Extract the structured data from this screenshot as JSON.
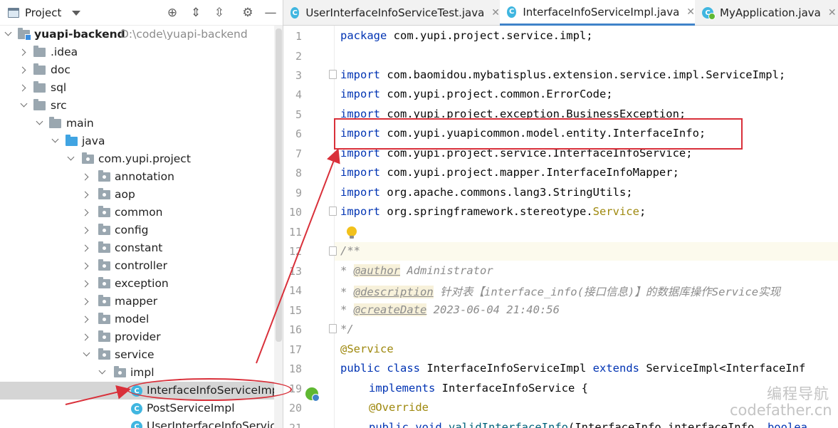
{
  "project_panel": {
    "title": "Project",
    "root": {
      "name": "yuapi-backend",
      "path": "D:\\code\\yuapi-backend"
    },
    "tree": [
      {
        "label": ".idea",
        "expanded": false
      },
      {
        "label": "doc",
        "expanded": false
      },
      {
        "label": "sql",
        "expanded": false
      },
      {
        "label": "src",
        "expanded": true
      },
      {
        "label": "main",
        "expanded": true
      },
      {
        "label": "java",
        "expanded": true
      },
      {
        "label": "com.yupi.project",
        "expanded": true
      },
      {
        "label": "annotation",
        "expanded": false
      },
      {
        "label": "aop",
        "expanded": false
      },
      {
        "label": "common",
        "expanded": false
      },
      {
        "label": "config",
        "expanded": false
      },
      {
        "label": "constant",
        "expanded": false
      },
      {
        "label": "controller",
        "expanded": false
      },
      {
        "label": "exception",
        "expanded": false
      },
      {
        "label": "mapper",
        "expanded": false
      },
      {
        "label": "model",
        "expanded": false
      },
      {
        "label": "provider",
        "expanded": false
      },
      {
        "label": "service",
        "expanded": true
      },
      {
        "label": "impl",
        "expanded": true
      },
      {
        "label": "InterfaceInfoServiceImpl",
        "selected": true
      },
      {
        "label": "PostServiceImpl"
      },
      {
        "label": "UserInterfaceInfoServiceImpl"
      }
    ],
    "class_icon_letter": "C"
  },
  "tabs": [
    {
      "label": "UserInterfaceInfoServiceTest.java",
      "active": false,
      "icon": "class-icon"
    },
    {
      "label": "InterfaceInfoServiceImpl.java",
      "active": true,
      "icon": "class-icon"
    },
    {
      "label": "MyApplication.java",
      "active": false,
      "icon": "spring-app-icon"
    }
  ],
  "tab_close_glyph": "✕",
  "editor": {
    "line_numbers": [
      "1",
      "2",
      "3",
      "4",
      "5",
      "6",
      "7",
      "8",
      "9",
      "10",
      "11",
      "12",
      "13",
      "14",
      "15",
      "16",
      "17",
      "18",
      "19",
      "20",
      "21"
    ],
    "lines": {
      "l1_kw": "package",
      "l1_rest": " com.yupi.project.service.impl;",
      "l3_kw": "import",
      "l3_rest": " com.baomidou.mybatisplus.extension.service.impl.ServiceImpl;",
      "l4_kw": "import",
      "l4_rest": " com.yupi.project.common.ErrorCode;",
      "l5_kw": "import",
      "l5_rest": " com.yupi.project.exception.BusinessException;",
      "l6_kw": "import",
      "l6_rest": " com.yupi.yuapicommon.model.entity.InterfaceInfo;",
      "l7_kw": "import",
      "l7_rest": " com.yupi.project.service.InterfaceInfoService;",
      "l8_kw": "import",
      "l8_rest": " com.yupi.project.mapper.InterfaceInfoMapper;",
      "l9_kw": "import",
      "l9_rest": " org.apache.commons.lang3.StringUtils;",
      "l10_kw": "import",
      "l10_rest": " org.springframework.stereotype.",
      "l10_svc": "Service",
      "l10_end": ";",
      "l12": "/**",
      "l13_star": "* ",
      "l13_tag": "@author",
      "l13_rest": " Administrator",
      "l14_star": "* ",
      "l14_tag": "@description",
      "l14_rest": " 针对表【interface_info(接口信息)】的数据库操作Service实现",
      "l15_star": "* ",
      "l15_tag": "@createDate",
      "l15_rest": " 2023-06-04 21:40:56",
      "l16": "*/",
      "l17": "@Service",
      "l18_kw1": "public",
      "l18_kw2": "class",
      "l18_name": " InterfaceInfoServiceImpl ",
      "l18_kw3": "extends",
      "l18_rest": " ServiceImpl<InterfaceInf",
      "l19_kw": "implements",
      "l19_rest": " InterfaceInfoService {",
      "l20": "@Override",
      "l21_kw1": "public",
      "l21_kw2": "void",
      "l21_fn": "validInterfaceInfo",
      "l21_rest": "(InterfaceInfo interfaceInfo, ",
      "l21_tail": "boolea"
    }
  },
  "watermark": {
    "chinese": "编程导航",
    "english": "codefather.cn"
  },
  "colors": {
    "annotation_red": "#d9303a",
    "keyword": "#0033b3",
    "tab_underline": "#4083c9"
  }
}
